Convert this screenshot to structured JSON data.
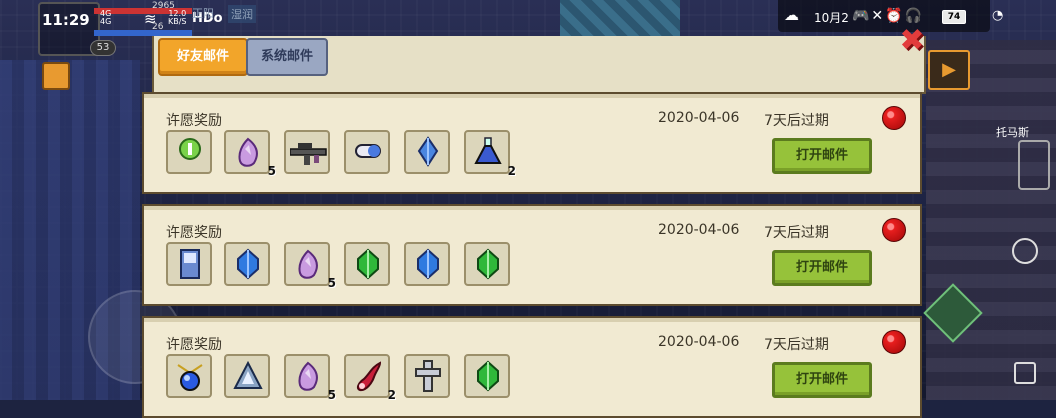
{
  "status_bar": {
    "time": "11:29",
    "net_top": "4G",
    "net_bottom": "4G",
    "speed_top": "12.0",
    "speed_bottom": "KB/S",
    "hd": "HDo",
    "date": "10月2",
    "battery": "74"
  },
  "hud": {
    "hp_label": "HP",
    "sp_label": "SP",
    "hp_value": "2965",
    "sp_value": "26",
    "level": "53",
    "dim_text_1": "正阳",
    "dim_text_2": "湿润"
  },
  "tabs": [
    {
      "label": "好友邮件",
      "active": true
    },
    {
      "label": "系统邮件",
      "active": false
    }
  ],
  "mails": [
    {
      "title": "许愿奖励",
      "date": "2020-04-06",
      "expire": "7天后过期",
      "open_label": "打开邮件",
      "items": [
        {
          "icon": "green-gem-coin-icon",
          "count": ""
        },
        {
          "icon": "purple-crystal-icon",
          "count": "5"
        },
        {
          "icon": "rifle-weapon-icon",
          "count": ""
        },
        {
          "icon": "blue-capsule-icon",
          "count": ""
        },
        {
          "icon": "blue-gem-icon",
          "count": ""
        },
        {
          "icon": "potion-flask-icon",
          "count": "2"
        }
      ]
    },
    {
      "title": "许愿奖励",
      "date": "2020-04-06",
      "expire": "7天后过期",
      "open_label": "打开邮件",
      "items": [
        {
          "icon": "blueprint-card-icon",
          "count": ""
        },
        {
          "icon": "blue-gem-icon",
          "count": ""
        },
        {
          "icon": "purple-crystal-icon",
          "count": "5"
        },
        {
          "icon": "green-gem-icon",
          "count": ""
        },
        {
          "icon": "blue-gem-icon",
          "count": ""
        },
        {
          "icon": "green-gem-icon",
          "count": ""
        }
      ]
    },
    {
      "title": "许愿奖励",
      "date": "2020-04-06",
      "expire": "7天后过期",
      "open_label": "打开邮件",
      "items": [
        {
          "icon": "sapphire-amulet-icon",
          "count": ""
        },
        {
          "icon": "triangle-rune-icon",
          "count": ""
        },
        {
          "icon": "purple-crystal-icon",
          "count": "5"
        },
        {
          "icon": "red-horn-icon",
          "count": "2"
        },
        {
          "icon": "silver-cross-icon",
          "count": ""
        },
        {
          "icon": "green-gem-icon",
          "count": ""
        }
      ]
    }
  ],
  "side": {
    "npc_label": "托马斯"
  },
  "colors": {
    "tab_active": "#f2a52a",
    "tab_inactive": "#9aa7c2",
    "panel_bg": "#f1ead2",
    "open_button": "#96c23a",
    "notify_dot": "#e81e1e"
  }
}
